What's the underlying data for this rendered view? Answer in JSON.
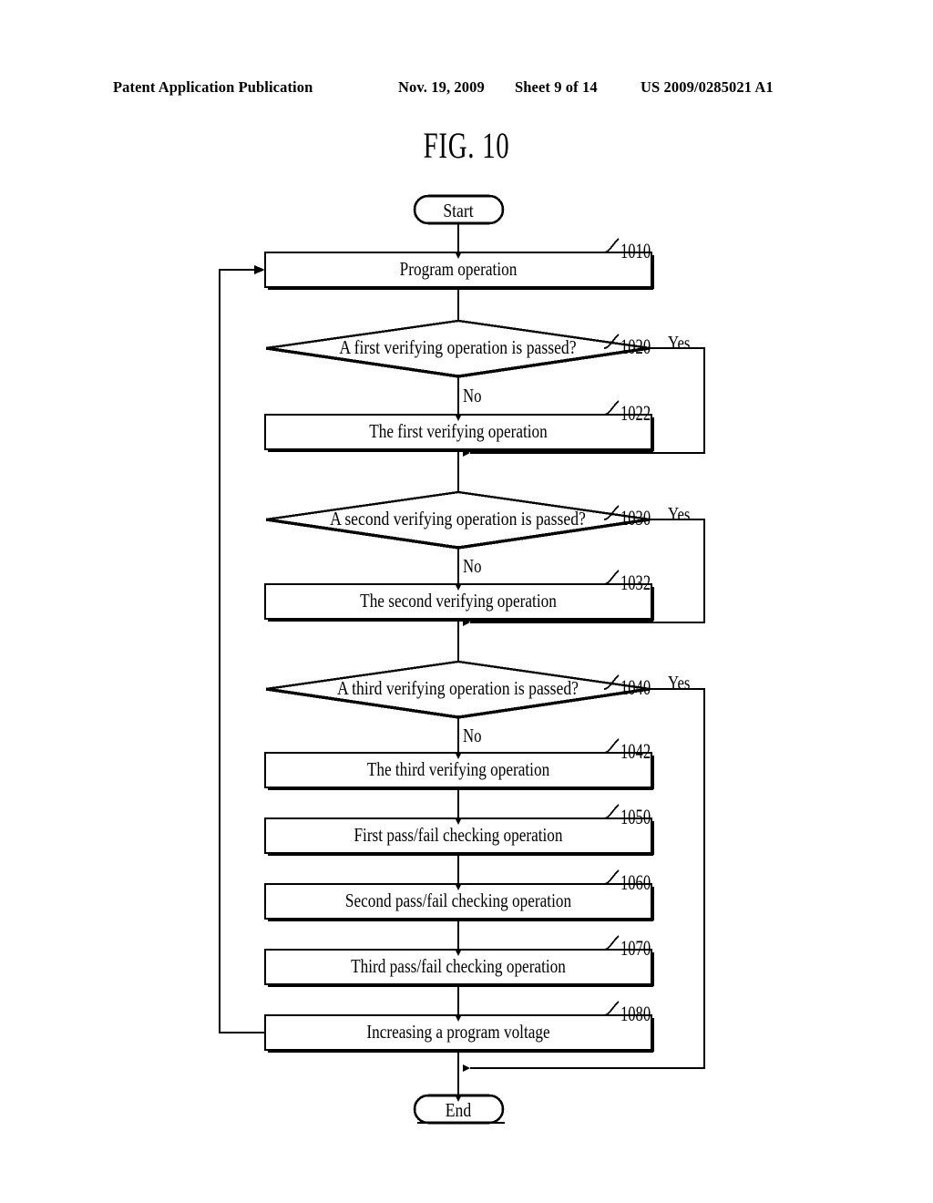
{
  "header": {
    "publication": "Patent Application Publication",
    "date": "Nov. 19, 2009",
    "sheet": "Sheet 9 of 14",
    "patent_number": "US 2009/0285021 A1"
  },
  "figure": {
    "title": "FIG. 10"
  },
  "flowchart": {
    "start_label": "Start",
    "end_label": "End",
    "yes_label": "Yes",
    "no_label": "No",
    "nodes": [
      {
        "id": "start",
        "type": "terminator",
        "label": "Start"
      },
      {
        "id": "n1010",
        "type": "process",
        "label": "Program operation",
        "ref": "1010"
      },
      {
        "id": "n1020",
        "type": "decision",
        "label": "A first verifying operation is passed?",
        "ref": "1020"
      },
      {
        "id": "n1022",
        "type": "process",
        "label": "The first verifying operation",
        "ref": "1022"
      },
      {
        "id": "n1030",
        "type": "decision",
        "label": "A second verifying operation is passed?",
        "ref": "1030"
      },
      {
        "id": "n1032",
        "type": "process",
        "label": "The second verifying operation",
        "ref": "1032"
      },
      {
        "id": "n1040",
        "type": "decision",
        "label": "A third verifying operation is passed?",
        "ref": "1040"
      },
      {
        "id": "n1042",
        "type": "process",
        "label": "The third verifying operation",
        "ref": "1042"
      },
      {
        "id": "n1050",
        "type": "process",
        "label": "First pass/fail checking operation",
        "ref": "1050"
      },
      {
        "id": "n1060",
        "type": "process",
        "label": "Second pass/fail checking operation",
        "ref": "1060"
      },
      {
        "id": "n1070",
        "type": "process",
        "label": "Third pass/fail checking operation",
        "ref": "1070"
      },
      {
        "id": "n1080",
        "type": "process",
        "label": "Increasing a program voltage",
        "ref": "1080"
      },
      {
        "id": "end",
        "type": "terminator",
        "label": "End"
      }
    ],
    "branches": [
      {
        "from": "n1020",
        "label": "Yes",
        "to": "below-n1022"
      },
      {
        "from": "n1020",
        "label": "No",
        "to": "n1022"
      },
      {
        "from": "n1030",
        "label": "Yes",
        "to": "below-n1032"
      },
      {
        "from": "n1030",
        "label": "No",
        "to": "n1032"
      },
      {
        "from": "n1040",
        "label": "Yes",
        "to": "above-end"
      },
      {
        "from": "n1040",
        "label": "No",
        "to": "n1042"
      },
      {
        "from": "n1080",
        "label": "",
        "to": "n1010"
      }
    ]
  },
  "colors": {
    "ink": "#000000",
    "page": "#ffffff"
  }
}
